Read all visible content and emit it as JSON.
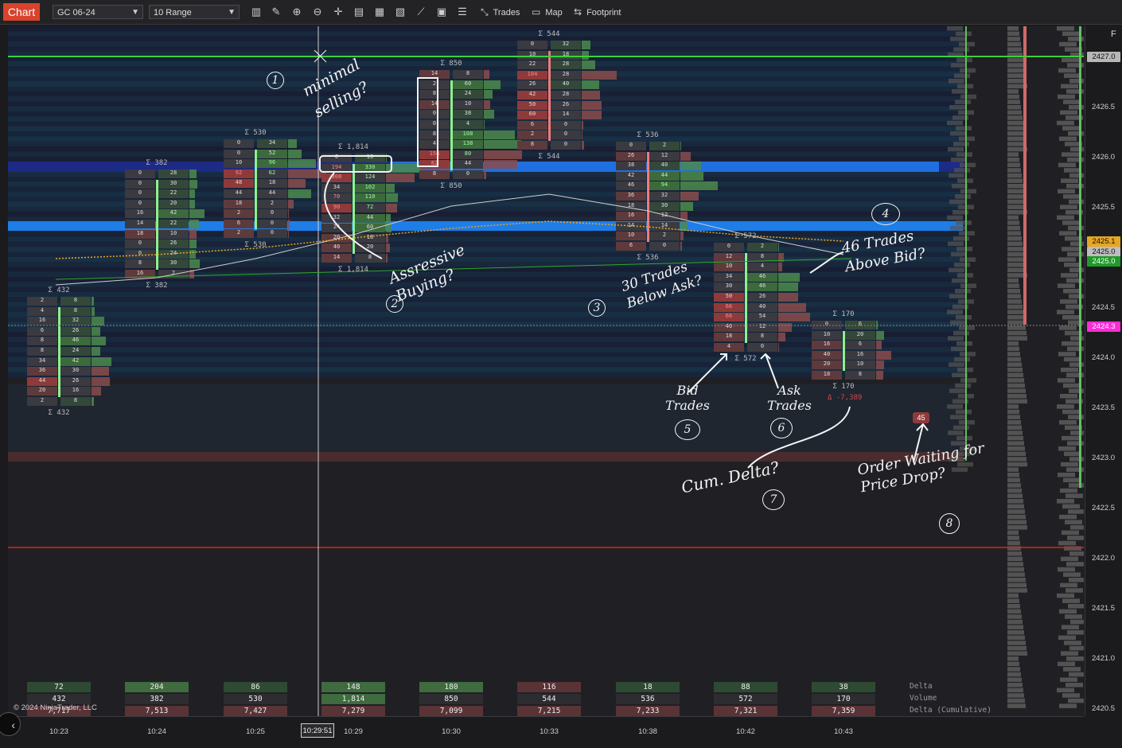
{
  "toolbar": {
    "chart_tab": "Chart",
    "instrument": "GC 06-24",
    "period": "10 Range",
    "buttons": {
      "trades": "Trades",
      "map": "Map",
      "footprint": "Footprint"
    }
  },
  "colors": {
    "accent": "#d9432b",
    "ask_green": "#5fbf5f",
    "bid_red": "#c24a4a",
    "line_green": "#3fcf3f",
    "line_red": "#e0201f",
    "magenta_tag": "#ff2bd6"
  },
  "price_axis": {
    "labels": [
      "2427.0",
      "2426.5",
      "2426.0",
      "2425.5",
      "2425.0",
      "2424.5",
      "2424.0",
      "2423.5",
      "2423.0",
      "2422.5",
      "2422.0",
      "2421.5",
      "2421.0",
      "2420.5"
    ],
    "tags": [
      {
        "text": "2427.0",
        "bg": "#b7b7b7",
        "fg": "#111"
      },
      {
        "text": "2425.1",
        "bg": "#e6a623",
        "fg": "#111"
      },
      {
        "text": "2425.0",
        "bg": "#bdbdbd",
        "fg": "#111"
      },
      {
        "text": "2425.0",
        "bg": "#1f9a2a",
        "fg": "#fff"
      },
      {
        "text": "2424.3",
        "bg": "#ff2bd6",
        "fg": "#fff"
      }
    ],
    "corner": "F"
  },
  "time_axis": {
    "labels": [
      "10:23",
      "10:24",
      "10:25",
      "10:29",
      "10:30",
      "10:33",
      "10:38",
      "10:42",
      "10:43"
    ],
    "cursor": "10:29:51"
  },
  "bars": [
    {
      "time": "10:23",
      "sigma": "Σ 432",
      "rows": [
        [
          "2",
          "8"
        ],
        [
          "4",
          "8"
        ],
        [
          "16",
          "32"
        ],
        [
          "6",
          "26"
        ],
        [
          "8",
          "46"
        ],
        [
          "8",
          "24"
        ],
        [
          "34",
          "42"
        ],
        [
          "36",
          "30"
        ],
        [
          "44",
          "26"
        ],
        [
          "20",
          "16"
        ],
        [
          "2",
          "8"
        ]
      ]
    },
    {
      "time": "10:24",
      "sigma": "Σ 382",
      "rows": [
        [
          "0",
          "28"
        ],
        [
          "0",
          "30"
        ],
        [
          "0",
          "22"
        ],
        [
          "0",
          "20"
        ],
        [
          "16",
          "42"
        ],
        [
          "14",
          "22"
        ],
        [
          "18",
          "10"
        ],
        [
          "0",
          "26"
        ],
        [
          "0",
          "24"
        ],
        [
          "8",
          "30"
        ],
        [
          "16",
          "2"
        ]
      ]
    },
    {
      "time": "10:25",
      "sigma": "Σ 530",
      "rows": [
        [
          "0",
          "34"
        ],
        [
          "0",
          "52"
        ],
        [
          "10",
          "96"
        ],
        [
          "92",
          "62"
        ],
        [
          "48",
          "18"
        ],
        [
          "44",
          "44"
        ],
        [
          "18",
          "2"
        ],
        [
          "2",
          "0"
        ],
        [
          "6",
          "0"
        ],
        [
          "2",
          "0"
        ]
      ]
    },
    {
      "time": "10:29",
      "sigma": "Σ 1,814",
      "rows": [
        [
          "0",
          "16"
        ],
        [
          "194",
          "330"
        ],
        [
          "308",
          "124"
        ],
        [
          "34",
          "102"
        ],
        [
          "70",
          "110"
        ],
        [
          "90",
          "72"
        ],
        [
          "32",
          "44"
        ],
        [
          "24",
          "60"
        ],
        [
          "20",
          "18"
        ],
        [
          "40",
          "20"
        ],
        [
          "14",
          "8"
        ]
      ]
    },
    {
      "time": "10:30",
      "sigma": "Σ 850",
      "rows": [
        [
          "14",
          "8"
        ],
        [
          "2",
          "60"
        ],
        [
          "8",
          "24"
        ],
        [
          "14",
          "10"
        ],
        [
          "0",
          "38"
        ],
        [
          "0",
          "4"
        ],
        [
          "8",
          "108"
        ],
        [
          "4",
          "138"
        ],
        [
          "154",
          "80"
        ],
        [
          "82",
          "44"
        ],
        [
          "8",
          "0"
        ]
      ]
    },
    {
      "time": "10:33",
      "sigma": "Σ 544",
      "rows": [
        [
          "0",
          "32"
        ],
        [
          "10",
          "18"
        ],
        [
          "22",
          "28"
        ],
        [
          "104",
          "28"
        ],
        [
          "26",
          "40"
        ],
        [
          "42",
          "28"
        ],
        [
          "50",
          "26"
        ],
        [
          "60",
          "14"
        ],
        [
          "6",
          "0"
        ],
        [
          "2",
          "0"
        ],
        [
          "8",
          "0"
        ]
      ]
    },
    {
      "time": "10:38",
      "sigma": "Σ 536",
      "rows": [
        [
          "0",
          "2"
        ],
        [
          "26",
          "12"
        ],
        [
          "38",
          "40"
        ],
        [
          "42",
          "44"
        ],
        [
          "46",
          "94"
        ],
        [
          "36",
          "32"
        ],
        [
          "18",
          "30"
        ],
        [
          "16",
          "12"
        ],
        [
          "14",
          "14"
        ],
        [
          "10",
          "2"
        ],
        [
          "6",
          "0"
        ]
      ]
    },
    {
      "time": "10:42",
      "sigma": "Σ 572",
      "rows": [
        [
          "0",
          "2"
        ],
        [
          "12",
          "8"
        ],
        [
          "10",
          "4"
        ],
        [
          "34",
          "46"
        ],
        [
          "30",
          "46"
        ],
        [
          "50",
          "26"
        ],
        [
          "66",
          "40"
        ],
        [
          "66",
          "54"
        ],
        [
          "40",
          "12"
        ],
        [
          "18",
          "8"
        ],
        [
          "4",
          "0"
        ]
      ]
    },
    {
      "time": "10:43",
      "sigma": "Σ 170",
      "delta_text": "Δ -7,389",
      "rows": [
        [
          "0",
          "6"
        ],
        [
          "10",
          "20"
        ],
        [
          "16",
          "6"
        ],
        [
          "40",
          "16"
        ],
        [
          "20",
          "10"
        ],
        [
          "18",
          "8"
        ]
      ]
    }
  ],
  "stats": {
    "labels": [
      "Delta",
      "Volume",
      "Delta (Cumulative)"
    ],
    "columns": [
      {
        "delta": "72",
        "volume": "432",
        "cum": "7,717"
      },
      {
        "delta": "204",
        "volume": "382",
        "cum": "7,513"
      },
      {
        "delta": "86",
        "volume": "530",
        "cum": "7,427"
      },
      {
        "delta": "148",
        "volume": "1,814",
        "cum": "7,279"
      },
      {
        "delta": "180",
        "volume": "850",
        "cum": "7,099"
      },
      {
        "delta": "116",
        "volume": "544",
        "cum": "7,215"
      },
      {
        "delta": "18",
        "volume": "536",
        "cum": "7,233"
      },
      {
        "delta": "88",
        "volume": "572",
        "cum": "7,321"
      },
      {
        "delta": "38",
        "volume": "170",
        "cum": "7,359"
      }
    ]
  },
  "copyright": "© 2024 NinjaTrader, LLC",
  "order_badge": "45",
  "annotations": {
    "n1": {
      "num": "1",
      "text": "minimal selling?"
    },
    "n2": {
      "num": "2",
      "text": "Assressive Buying?"
    },
    "n3": {
      "num": "3",
      "text": "30 Trades Below Ask?"
    },
    "n4": {
      "num": "4",
      "text": "46 Trades Above Bid?"
    },
    "n5": {
      "num": "5",
      "text": "Bid Trades"
    },
    "n6": {
      "num": "6",
      "text": "Ask Trades"
    },
    "n7": {
      "num": "7",
      "text": "Cum. Delta?"
    },
    "n8": {
      "num": "8",
      "text": "Order Waiting for Price Drop?"
    }
  }
}
